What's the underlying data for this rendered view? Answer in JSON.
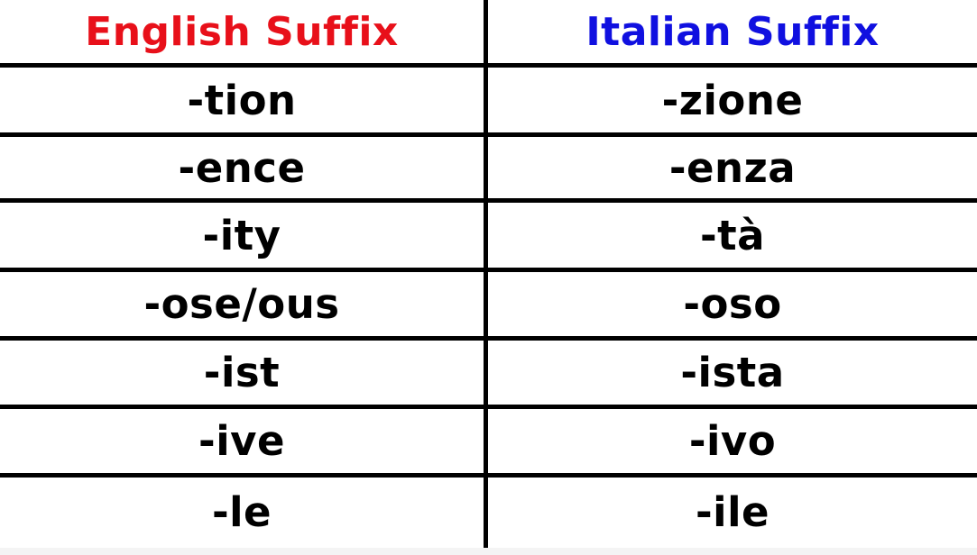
{
  "header": {
    "english": "English Suffix",
    "italian": "Italian Suffix"
  },
  "colors": {
    "english_header": "#e8101a",
    "italian_header": "#1010e0",
    "text": "#000000",
    "rules": "#000000"
  },
  "rows": [
    {
      "english": "-tion",
      "italian": "-zione"
    },
    {
      "english": "-ence",
      "italian": "-enza"
    },
    {
      "english": "-ity",
      "italian": "-tà"
    },
    {
      "english": "-ose/ous",
      "italian": "-oso"
    },
    {
      "english": "-ist",
      "italian": "-ista"
    },
    {
      "english": "-ive",
      "italian": "-ivo"
    },
    {
      "english": "-le",
      "italian": "-ile"
    }
  ]
}
